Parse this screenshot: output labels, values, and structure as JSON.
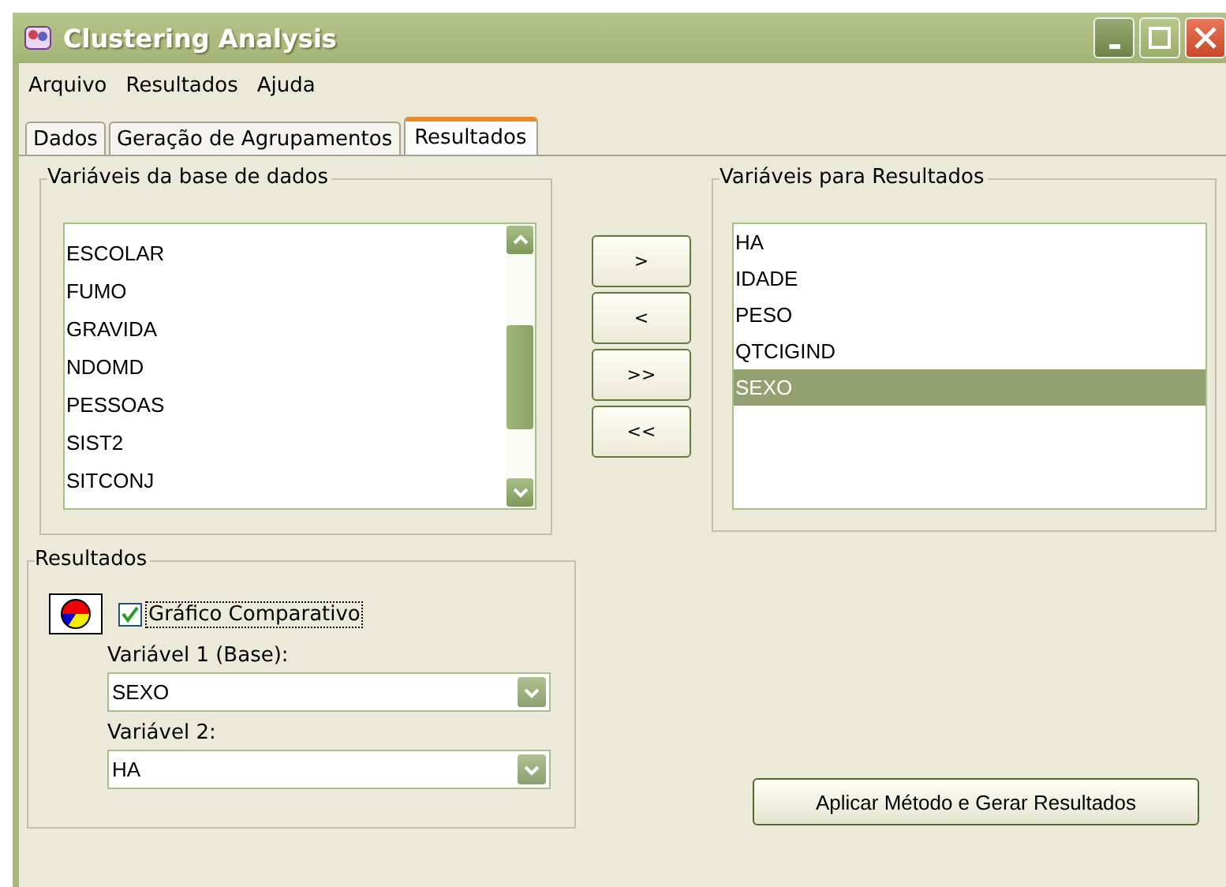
{
  "window": {
    "title": "Clustering Analysis"
  },
  "menu": [
    "Arquivo",
    "Resultados",
    "Ajuda"
  ],
  "tabs": [
    {
      "label": "Dados",
      "selected": false
    },
    {
      "label": "Geração de Agrupamentos",
      "selected": false
    },
    {
      "label": "Resultados",
      "selected": true
    }
  ],
  "source_group": {
    "title": "Variáveis da base de dados",
    "items": [
      {
        "label": "ESCOLAR",
        "selected": false
      },
      {
        "label": "FUMO",
        "selected": false
      },
      {
        "label": "GRAVIDA",
        "selected": false
      },
      {
        "label": "NDOMD",
        "selected": false
      },
      {
        "label": "PESSOAS",
        "selected": false
      },
      {
        "label": "SIST2",
        "selected": false
      },
      {
        "label": "SITCONJ",
        "selected": false
      }
    ]
  },
  "move_buttons": [
    ">",
    "<",
    ">>",
    "<<"
  ],
  "target_group": {
    "title": "Variáveis para Resultados",
    "items": [
      {
        "label": "HA",
        "selected": false
      },
      {
        "label": "IDADE",
        "selected": false
      },
      {
        "label": "PESO",
        "selected": false
      },
      {
        "label": "QTCIGIND",
        "selected": false
      },
      {
        "label": "SEXO",
        "selected": true
      }
    ]
  },
  "results_group": {
    "title": "Resultados",
    "chart_checkbox": {
      "label": "Gráfico Comparativo",
      "checked": true
    },
    "fields": [
      {
        "label": "Variável 1 (Base):",
        "value": "SEXO"
      },
      {
        "label": "Variável 2:",
        "value": "HA"
      }
    ]
  },
  "apply_button": "Aplicar Método e Gerar Resultados"
}
